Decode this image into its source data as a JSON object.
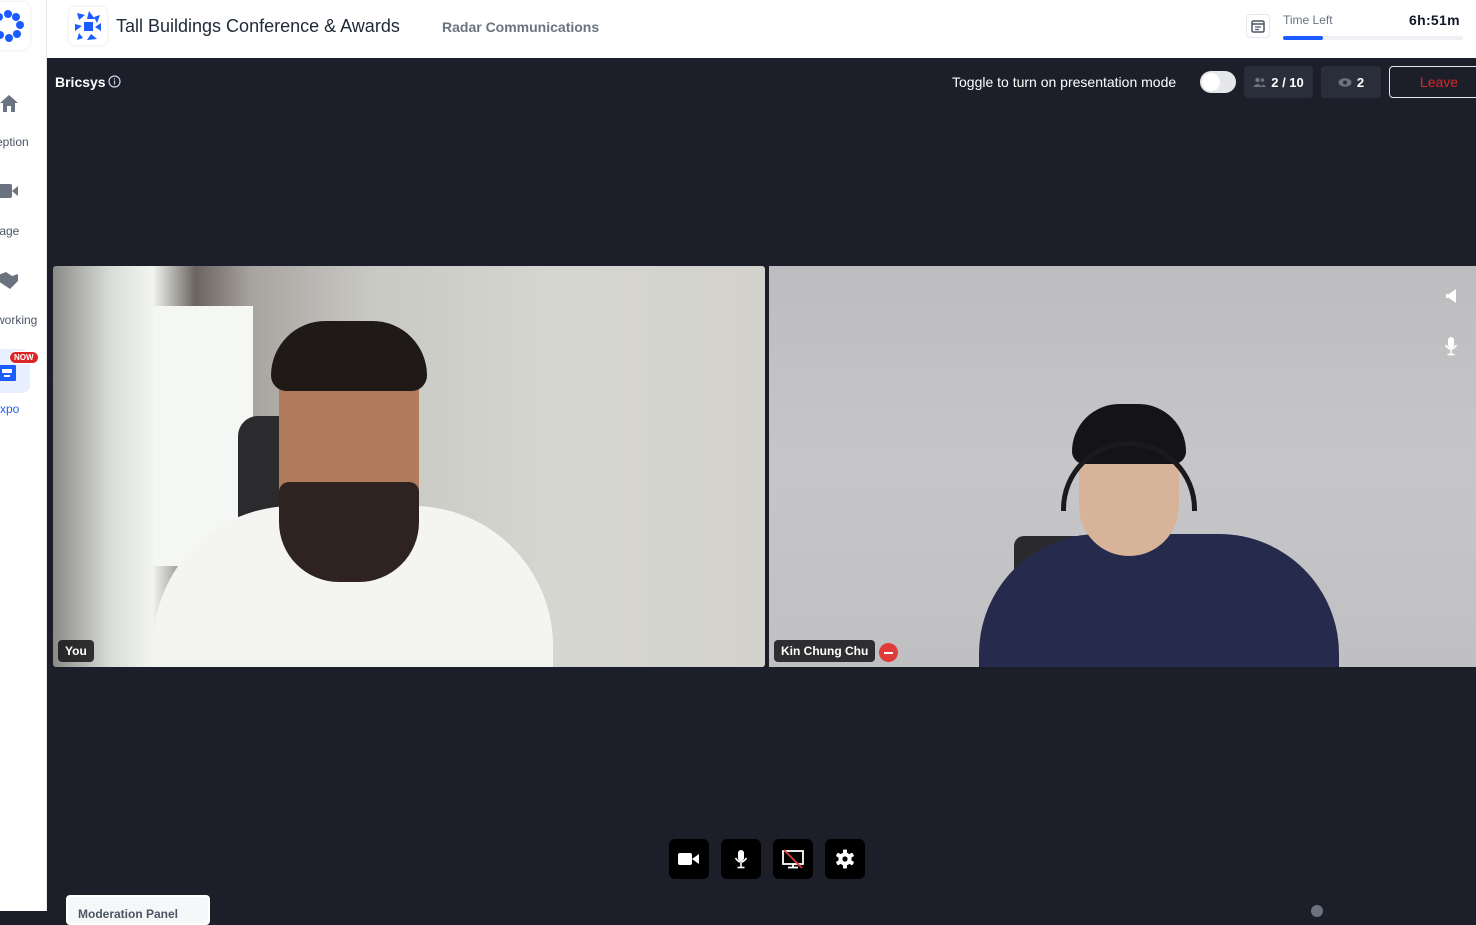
{
  "sidebar": {
    "items": [
      {
        "label": "Reception",
        "visible_label": "eption",
        "icon": "home-icon"
      },
      {
        "label": "Stage",
        "visible_label": "tage",
        "icon": "video-camera-icon"
      },
      {
        "label": "Networking",
        "visible_label": "working",
        "icon": "handshake-icon"
      },
      {
        "label": "Expo",
        "visible_label": "xpo",
        "icon": "booth-icon",
        "badge": "NOW",
        "active": true
      }
    ]
  },
  "header": {
    "event_title": "Tall Buildings Conference & Awards",
    "organization": "Radar Communications",
    "time_left_label": "Time Left",
    "time_left_value": "6h:51m",
    "time_progress_percent": 22
  },
  "room": {
    "name": "Bricsys",
    "presentation_toggle_label": "Toggle to turn on presentation mode",
    "presentation_mode": false,
    "participants": "2 / 10",
    "viewers": "2",
    "leave_label": "Leave"
  },
  "participants": [
    {
      "name": "You",
      "muted": false
    },
    {
      "name": "Kin Chung Chu",
      "muted": true
    }
  ],
  "controls": [
    {
      "name": "camera",
      "icon": "video-camera-icon"
    },
    {
      "name": "microphone",
      "icon": "microphone-icon"
    },
    {
      "name": "screen-share",
      "icon": "screen-share-off-icon"
    },
    {
      "name": "settings",
      "icon": "gear-icon"
    }
  ],
  "bottom": {
    "moderation_card": "Moderation Panel"
  },
  "colors": {
    "accent": "#1a5cff",
    "background": "#1c1f29",
    "leave": "#dc2626",
    "muted_badge": "#e03b3b"
  }
}
